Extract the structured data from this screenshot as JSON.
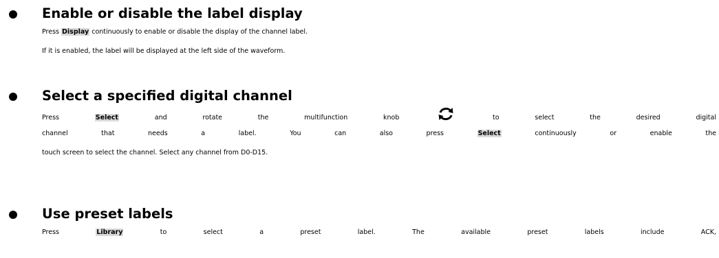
{
  "items": [
    {
      "title": "Enable or disable the label display",
      "lines": [
        {
          "pre": "Press ",
          "key": "Display",
          "post": " continuously to enable or disable the display of the channel label."
        },
        {
          "text": "If it is enabled, the label will be displayed at the left side of the waveform."
        }
      ]
    },
    {
      "title": "Select a specified digital channel",
      "lines": [
        {
          "pre": "Press ",
          "key": "Select",
          "post_a": " and rotate the multifunction knob ",
          "icon": "rotate-knob-icon",
          "post_b": " to select the desired digital"
        },
        {
          "pre": "channel that needs a label. You can also press ",
          "key": "Select",
          "post": " continuously or enable the"
        },
        {
          "text": "touch screen to select the channel. Select any channel from D0-D15."
        }
      ]
    },
    {
      "title": "Use preset labels",
      "lines": [
        {
          "pre": "Press ",
          "key": "Library",
          "post": " to select a preset label. The available preset labels include ACK,"
        }
      ]
    }
  ]
}
